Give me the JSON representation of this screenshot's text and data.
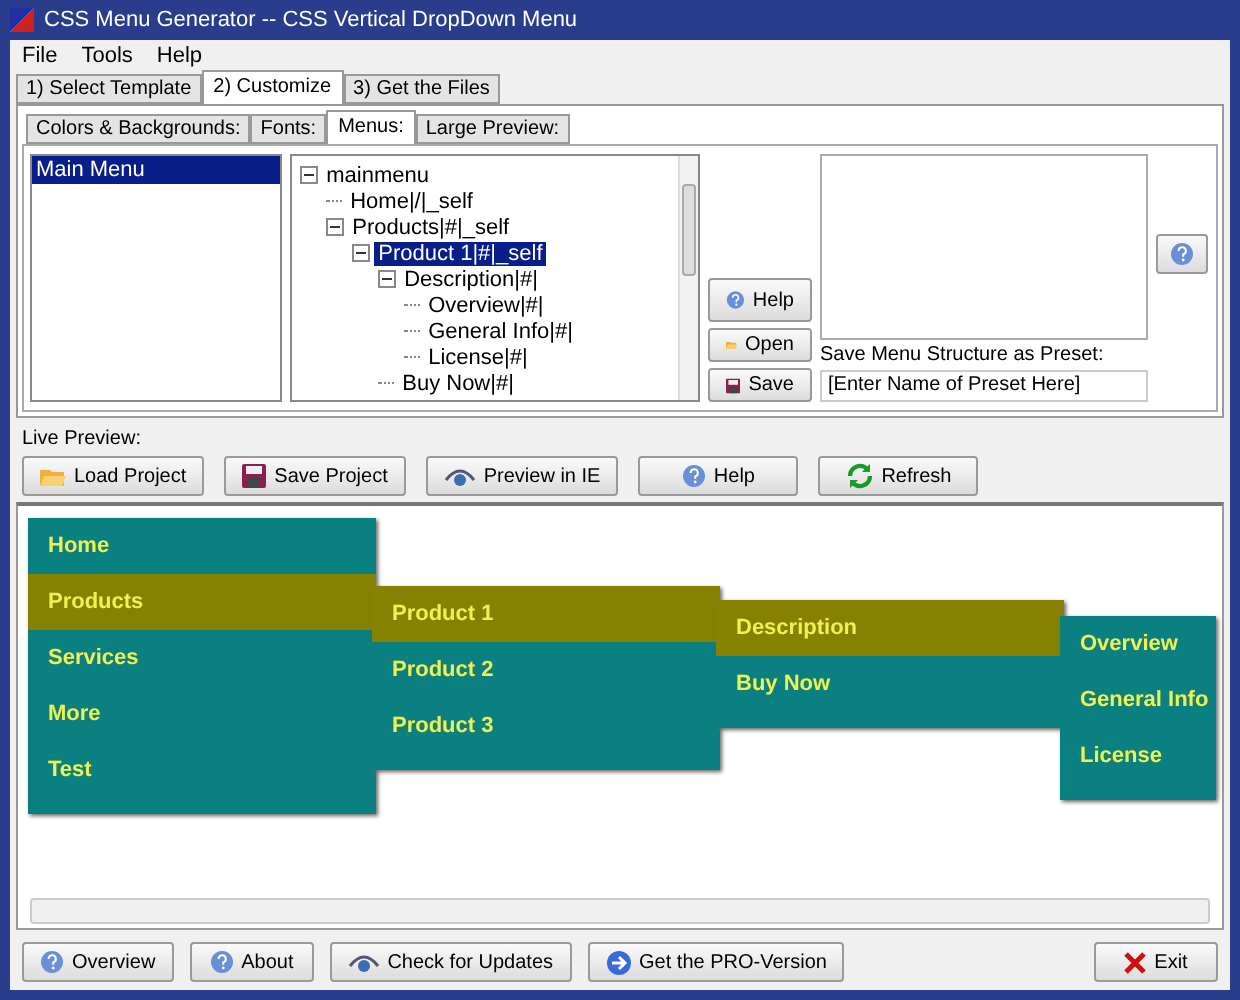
{
  "window": {
    "title": "CSS Menu Generator -- CSS Vertical DropDown Menu"
  },
  "menubar": [
    "File",
    "Tools",
    "Help"
  ],
  "tabs": [
    {
      "label": "1) Select Template",
      "selected": false
    },
    {
      "label": "2) Customize",
      "selected": true
    },
    {
      "label": "3) Get the Files",
      "selected": false
    }
  ],
  "subtabs": [
    {
      "label": "Colors & Backgrounds:",
      "selected": false
    },
    {
      "label": "Fonts:",
      "selected": false
    },
    {
      "label": "Menus:",
      "selected": true
    },
    {
      "label": "Large Preview:",
      "selected": false
    }
  ],
  "menu_list": [
    {
      "label": "Main Menu",
      "selected": true
    }
  ],
  "tree": [
    {
      "label": "mainmenu",
      "selected": false,
      "expanded": true,
      "children": [
        {
          "label": "Home|/|_self",
          "selected": false
        },
        {
          "label": "Products|#|_self",
          "selected": false,
          "expanded": true,
          "children": [
            {
              "label": "Product 1|#|_self",
              "selected": true,
              "expanded": true,
              "children": [
                {
                  "label": "Description|#|",
                  "selected": false,
                  "expanded": true,
                  "children": [
                    {
                      "label": "Overview|#|",
                      "selected": false
                    },
                    {
                      "label": "General Info|#|",
                      "selected": false
                    },
                    {
                      "label": "License|#|",
                      "selected": false
                    }
                  ]
                },
                {
                  "label": "Buy Now|#|",
                  "selected": false
                }
              ]
            }
          ]
        }
      ]
    }
  ],
  "tree_buttons": [
    "Help",
    "Open",
    "Save"
  ],
  "preset": {
    "label": "Save Menu Structure as Preset:",
    "value": "[Enter Name of Preset Here]"
  },
  "live_preview": {
    "label": "Live Preview:"
  },
  "toolbar": [
    "Load Project",
    "Save Project",
    "Preview in IE",
    "Help",
    "Refresh"
  ],
  "preview_menus": [
    [
      {
        "label": "Home",
        "selected": false
      },
      {
        "label": "Products",
        "selected": true
      },
      {
        "label": "Services",
        "selected": false
      },
      {
        "label": "More",
        "selected": false
      },
      {
        "label": "Test",
        "selected": false
      }
    ],
    [
      {
        "label": "Product 1",
        "selected": true
      },
      {
        "label": "Product 2",
        "selected": false
      },
      {
        "label": "Product 3",
        "selected": false
      }
    ],
    [
      {
        "label": "Description",
        "selected": true
      },
      {
        "label": "Buy Now",
        "selected": false
      }
    ],
    [
      {
        "label": "Overview",
        "selected": false
      },
      {
        "label": "General Info",
        "selected": false
      },
      {
        "label": "License",
        "selected": false
      }
    ]
  ],
  "footer_buttons": [
    "Overview",
    "About",
    "Check for Updates",
    "Get the PRO-Version",
    "Exit"
  ]
}
